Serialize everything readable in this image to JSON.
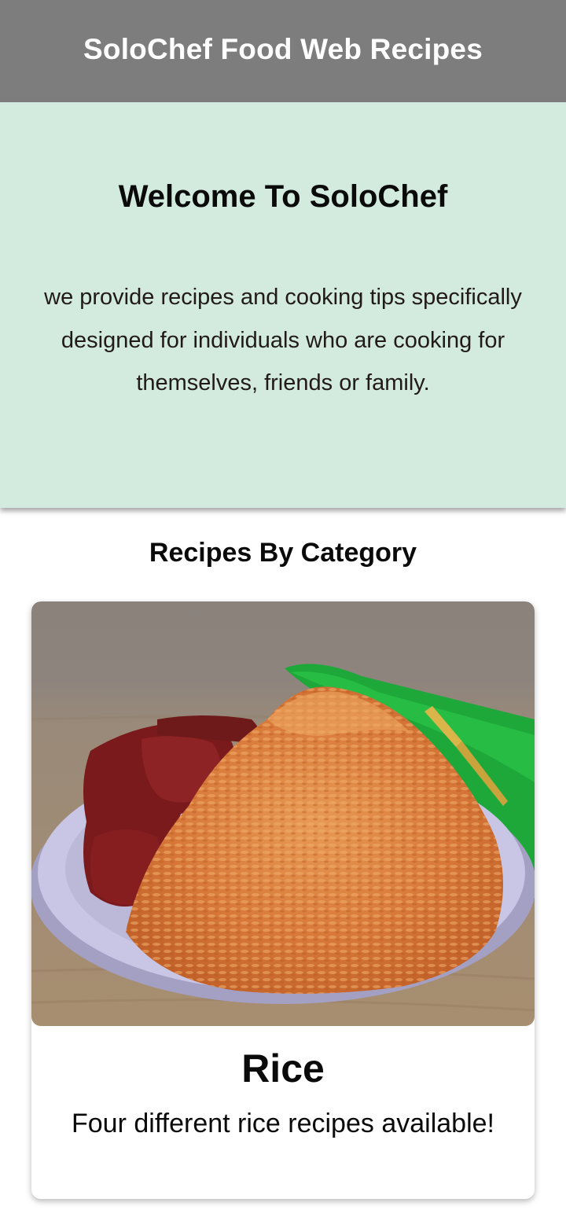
{
  "header": {
    "title": "SoloChef Food Web Recipes",
    "color": "#7d7d7d"
  },
  "hero": {
    "title": "Welcome To SoloChef",
    "text": "we provide recipes and cooking tips specifically designed for individuals who are cooking for themselves, friends or family.",
    "background": "#d2ebde"
  },
  "categories": {
    "section_title": "Recipes By Category",
    "items": [
      {
        "title": "Rice",
        "subtitle": "Four different rice recipes available!",
        "image": "jollof-rice-photo"
      }
    ]
  }
}
